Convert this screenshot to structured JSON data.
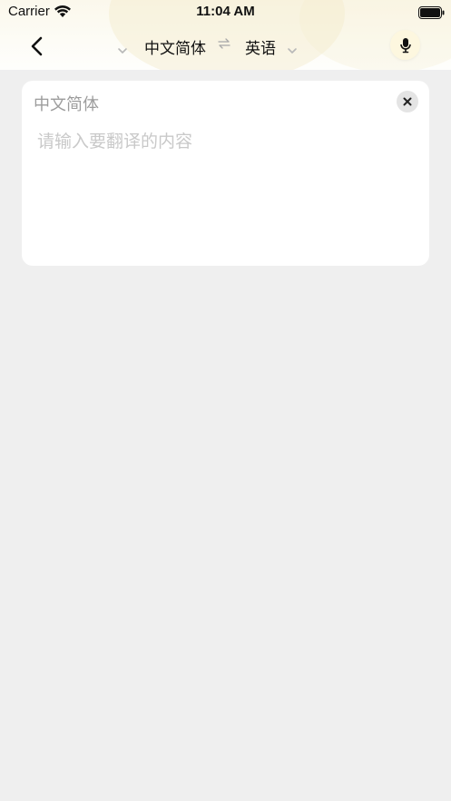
{
  "status_bar": {
    "carrier": "Carrier",
    "time": "11:04 AM"
  },
  "nav": {
    "source_language": "中文简体",
    "target_language": "英语",
    "swap_icon": "swap-arrows-icon",
    "back_icon": "chevron-left-icon",
    "mic_icon": "microphone-icon"
  },
  "input_card": {
    "language_label": "中文简体",
    "placeholder": "请输入要翻译的内容",
    "value": "",
    "clear_icon": "close-icon"
  },
  "colors": {
    "header_tint": "#fbf8ec",
    "background": "#efefef",
    "card": "#ffffff",
    "mic_button": "#fdf7df"
  }
}
